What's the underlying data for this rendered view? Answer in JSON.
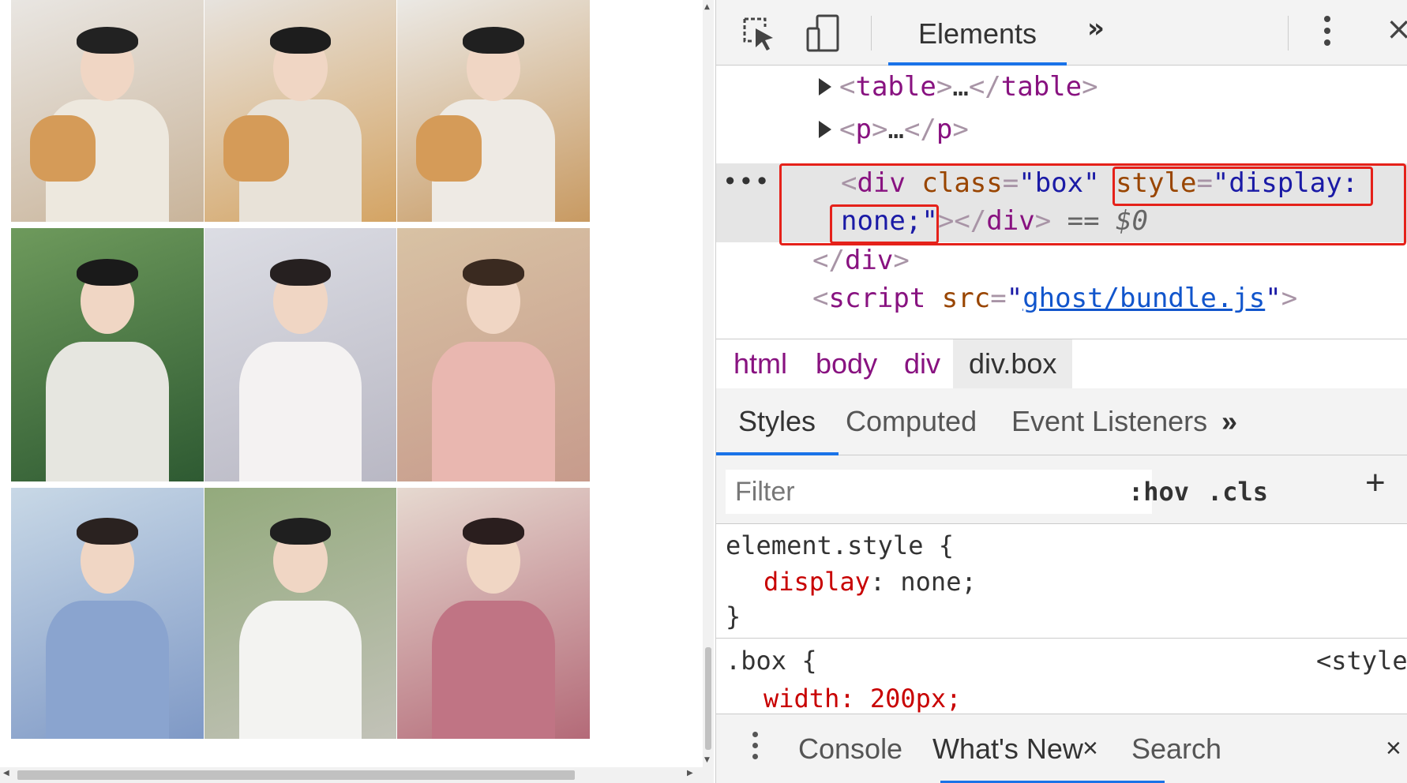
{
  "page": {
    "photos": [
      {
        "name": "photo-boy-with-corgi-bed",
        "bg": "#e9e6e2",
        "accent": "#c9b49a",
        "shirt": "#ede8de",
        "hair": "#222"
      },
      {
        "name": "photo-boy-with-corgi-sitting",
        "bg": "#e7e3de",
        "accent": "#d4a464",
        "shirt": "#e8e2d8",
        "hair": "#1d1d1d"
      },
      {
        "name": "photo-boy-with-corgi-arm-raised",
        "bg": "#ebe9e5",
        "accent": "#c89a62",
        "shirt": "#eeeae4",
        "hair": "#202020"
      },
      {
        "name": "photo-boy-in-leaves",
        "bg": "#6e9a5c",
        "accent": "#2e5a32",
        "shirt": "#e6e6e0",
        "hair": "#1a1a1a"
      },
      {
        "name": "photo-boy-with-glasses",
        "bg": "#dcdde4",
        "accent": "#b9b8c4",
        "shirt": "#f4f2f2",
        "hair": "#262020"
      },
      {
        "name": "photo-boy-eyes-closed-choker",
        "bg": "#d8c2a4",
        "accent": "#c79b8c",
        "shirt": "#e9b7b0",
        "hair": "#3a2a20"
      },
      {
        "name": "photo-boy-blue-shirt",
        "bg": "#c8d8e6",
        "accent": "#7f99c6",
        "shirt": "#8aa4cf",
        "hair": "#2a2220"
      },
      {
        "name": "photo-boy-white-tee-garden",
        "bg": "#93aa7c",
        "accent": "#c2c2b8",
        "shirt": "#f3f3f1",
        "hair": "#1f1f1f"
      },
      {
        "name": "photo-boy-pink-hoodie",
        "bg": "#e6d9d0",
        "accent": "#b46a78",
        "shirt": "#c07484",
        "hair": "#2a1e1e"
      }
    ]
  },
  "devtools": {
    "toolbar": {
      "inspect_icon": "inspect-element-icon",
      "device_icon": "device-toolbar-icon",
      "active_tab": "Elements",
      "more_tabs": "»",
      "menu_icon": "vertical-dots-icon",
      "close": "×"
    },
    "dom": {
      "line0": {
        "open": "<",
        "tag": "table",
        "close": ">",
        "ellip": "…",
        "endopen": "</",
        "endtag": "table",
        "endclose": ">"
      },
      "line1": {
        "open": "<",
        "tag": "p",
        "close": ">",
        "ellip": "…",
        "endopen": "</",
        "endtag": "p",
        "endclose": ">"
      },
      "selected": {
        "dots": "•••",
        "open": "<",
        "tag": "div",
        "attr1": "class",
        "eq": "=",
        "val1": "\"box\"",
        "attr2": "style",
        "val2a": "\"display:",
        "val2b": "none;\"",
        "tail1": ">",
        "tail2": "</",
        "tail3": "div",
        "tail4": ">",
        "eqs": "== $0"
      },
      "line3": {
        "open": "</",
        "tag": "div",
        "close": ">"
      },
      "line4": {
        "open": "<",
        "tag": "script",
        "attr": "src",
        "eq": "=",
        "q1": "\"",
        "link": "ghost/bundle.js",
        "q2": "\"",
        "close": ">"
      }
    },
    "breadcrumb": [
      "html",
      "body",
      "div",
      "div.box"
    ],
    "styles_tabs": {
      "styles": "Styles",
      "computed": "Computed",
      "listeners": "Event Listeners",
      "more": "»"
    },
    "filter": {
      "placeholder": "Filter",
      "hov": ":hov",
      "cls": ".cls",
      "plus": "+"
    },
    "rules": {
      "element_selector": "element.style {",
      "element_prop": "display",
      "element_value": ": none;",
      "close_brace": "}",
      "box_selector": ".box {",
      "box_source": "<style",
      "box_prop_partial": "width: 200px;"
    },
    "drawer": {
      "console": "Console",
      "whats_new": "What's New",
      "close_tab": "×",
      "search": "Search",
      "close": "×"
    }
  }
}
